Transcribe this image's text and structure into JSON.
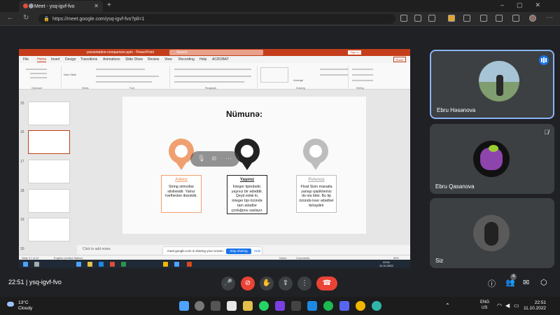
{
  "browser": {
    "tab_title": "Meet - ysq-igvf-fvo",
    "url": "https://meet.google.com/ysq-igvf-fvo?pli=1"
  },
  "ppt": {
    "file_name": "presentation-comparison.pptx - PowerPoint",
    "search": "Search",
    "sign_in": "Sign in",
    "share": "Share",
    "menu": [
      "File",
      "Home",
      "Insert",
      "Design",
      "Transitions",
      "Animations",
      "Slide Show",
      "Review",
      "View",
      "Recording",
      "Help",
      "ACROBAT"
    ],
    "ribbon_groups": [
      "Clipboard",
      "Slides",
      "Font",
      "Paragraph",
      "Drawing",
      "Editing"
    ],
    "ribbon_new_slide": "New Slide",
    "ribbon_arrange": "Arrange",
    "thumb_numbers": [
      "15",
      "16",
      "17",
      "18",
      "19",
      "20"
    ],
    "notes_placeholder": "Click to add notes",
    "status_left": "Slide 17 of 22",
    "status_lang": "English (United States)",
    "status_notes": "Notes",
    "status_comments": "Comments",
    "zoom": "56%"
  },
  "slide": {
    "title": "Nümunə:",
    "boxes": [
      {
        "heading": "Adınız",
        "text": "String simvollar silsiləsidir. Yalnız hərflərdən ibarətdir."
      },
      {
        "heading": "Yaşınız",
        "text": "İnteger tipindədir, yaşınız bir ədəddir. Qeyd edək ki, integer tipi özündə tam ədədlər çoxluğunu saxlayır."
      },
      {
        "heading": "Pulunuz",
        "text": "Float Sizin manatla yanaşı qəpikləriniz də ola bilər. Bu tip özündə kəsr ədədləri birləşdirir"
      }
    ]
  },
  "sharing": {
    "message": "meet.google.com is sharing your screen.",
    "stop": "Stop sharing",
    "hide": "Hide"
  },
  "participants": [
    {
      "name": "Ebru Həsənova"
    },
    {
      "name": "Ebru Qasanova"
    },
    {
      "name": "Siz"
    }
  ],
  "meet": {
    "time_code": "22:51 | ysq-igvf-fvo",
    "people_count": "4"
  },
  "taskbar": {
    "temp": "13°C",
    "weather": "Cloudy",
    "lang_1": "ENG",
    "lang_2": "US",
    "time": "22:51",
    "date": "11.10.2022",
    "inner_time": "22:51",
    "inner_date": "11.10.2022"
  },
  "colors": {
    "ppt_accent": "#c43e1c",
    "pin_orange": "#f0a070",
    "pin_black": "#222222",
    "pin_gray": "#bdbdbd",
    "end_call": "#ea4335",
    "meet_blue": "#8ab4f8"
  }
}
